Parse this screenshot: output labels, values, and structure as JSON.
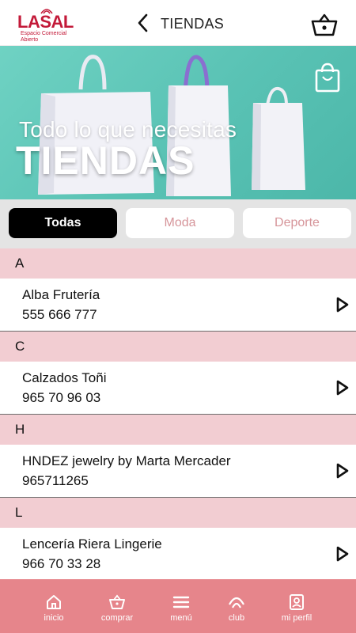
{
  "header": {
    "logo_text": "LASAL",
    "logo_subtitle": "Espacio Comercial Abierto",
    "title": "TIENDAS",
    "back_icon": "chevron-left-icon",
    "cart_icon": "basket-icon"
  },
  "hero": {
    "subtitle": "Todo lo que necesitas",
    "title": "TIENDAS",
    "bag_icon": "shopping-bag-icon",
    "background_color": "#5cc5b7"
  },
  "filters": {
    "tabs": [
      {
        "label": "Todas",
        "active": true
      },
      {
        "label": "Moda",
        "active": false
      },
      {
        "label": "Deporte",
        "active": false
      }
    ]
  },
  "sections": [
    {
      "letter": "A",
      "stores": [
        {
          "name": "Alba Frutería",
          "phone": "555 666 777"
        }
      ]
    },
    {
      "letter": "C",
      "stores": [
        {
          "name": "Calzados Toñi",
          "phone": "965 70 96 03"
        }
      ]
    },
    {
      "letter": "H",
      "stores": [
        {
          "name": "HNDEZ jewelry by Marta Mercader",
          "phone": "965711265"
        }
      ]
    },
    {
      "letter": "L",
      "stores": [
        {
          "name": "Lencería Riera Lingerie",
          "phone": "966 70 33 28"
        }
      ]
    }
  ],
  "bottom_nav": {
    "items": [
      {
        "label": "inicio",
        "icon": "home-icon"
      },
      {
        "label": "comprar",
        "icon": "basket-icon"
      },
      {
        "label": "menú",
        "icon": "menu-icon"
      },
      {
        "label": "club",
        "icon": "club-icon"
      },
      {
        "label": "mi perfil",
        "icon": "profile-icon"
      }
    ]
  },
  "colors": {
    "brand": "#c31a39",
    "section_header": "#f2cdd2",
    "nav_background": "#e6858b",
    "filter_inactive_text": "#d6959a",
    "filter_active_bg": "#000000"
  }
}
